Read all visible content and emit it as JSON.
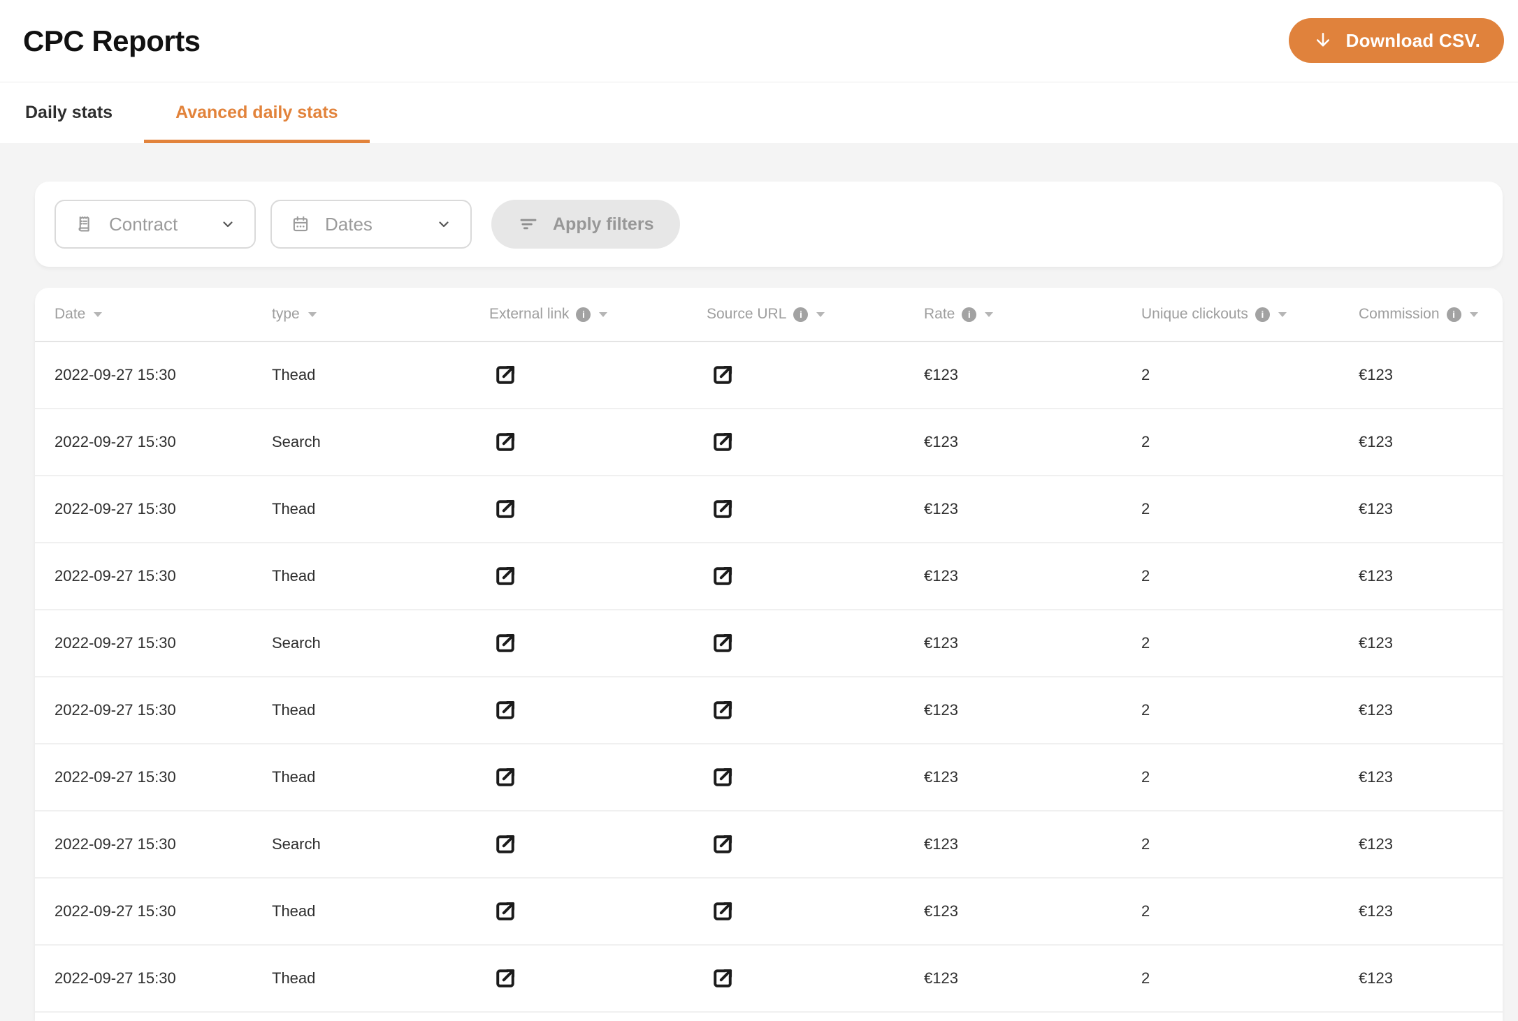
{
  "header": {
    "title": "CPC Reports",
    "download_label": "Download CSV."
  },
  "tabs": {
    "items": [
      {
        "label": "Daily stats",
        "active": false
      },
      {
        "label": "Avanced daily stats",
        "active": true
      }
    ]
  },
  "filters": {
    "contract_label": "Contract",
    "dates_label": "Dates",
    "apply_label": "Apply filters"
  },
  "table": {
    "columns": [
      {
        "label": "Date",
        "has_info": false,
        "sortable": true
      },
      {
        "label": "type",
        "has_info": false,
        "sortable": true
      },
      {
        "label": "External link",
        "has_info": true,
        "sortable": true
      },
      {
        "label": "Source URL",
        "has_info": true,
        "sortable": true
      },
      {
        "label": "Rate",
        "has_info": true,
        "sortable": true
      },
      {
        "label": "Unique clickouts",
        "has_info": true,
        "sortable": true
      },
      {
        "label": "Commission",
        "has_info": true,
        "sortable": true
      }
    ],
    "rows": [
      {
        "date": "2022-09-27 15:30",
        "type": "Thead",
        "rate": "€123",
        "unique_clickouts": "2",
        "commission": "€123"
      },
      {
        "date": "2022-09-27 15:30",
        "type": "Search",
        "rate": "€123",
        "unique_clickouts": "2",
        "commission": "€123"
      },
      {
        "date": "2022-09-27 15:30",
        "type": "Thead",
        "rate": "€123",
        "unique_clickouts": "2",
        "commission": "€123"
      },
      {
        "date": "2022-09-27 15:30",
        "type": "Thead",
        "rate": "€123",
        "unique_clickouts": "2",
        "commission": "€123"
      },
      {
        "date": "2022-09-27 15:30",
        "type": "Search",
        "rate": "€123",
        "unique_clickouts": "2",
        "commission": "€123"
      },
      {
        "date": "2022-09-27 15:30",
        "type": "Thead",
        "rate": "€123",
        "unique_clickouts": "2",
        "commission": "€123"
      },
      {
        "date": "2022-09-27 15:30",
        "type": "Thead",
        "rate": "€123",
        "unique_clickouts": "2",
        "commission": "€123"
      },
      {
        "date": "2022-09-27 15:30",
        "type": "Search",
        "rate": "€123",
        "unique_clickouts": "2",
        "commission": "€123"
      },
      {
        "date": "2022-09-27 15:30",
        "type": "Thead",
        "rate": "€123",
        "unique_clickouts": "2",
        "commission": "€123"
      },
      {
        "date": "2022-09-27 15:30",
        "type": "Thead",
        "rate": "€123",
        "unique_clickouts": "2",
        "commission": "€123"
      }
    ]
  },
  "icons": {
    "download": "arrow-down",
    "contract": "receipt",
    "dates": "calendar",
    "apply": "filter-lines",
    "select_caret": "chevron-down",
    "column_info": "info-circle",
    "column_sort": "caret-down",
    "external_link": "open-in-new"
  },
  "colors": {
    "accent": "#E2833B",
    "button-orange": "#E0823C",
    "page-bg": "#F4F4F4",
    "card-bg": "#FFFFFF",
    "muted": "#9B9B9B",
    "header-text": "#9E9E9E",
    "dark-text": "#2E2E2E",
    "border": "#DADADA",
    "row-divider": "#F0F0F0",
    "header-divider": "#E4E4E4",
    "apply-bg": "#E7E7E7"
  }
}
